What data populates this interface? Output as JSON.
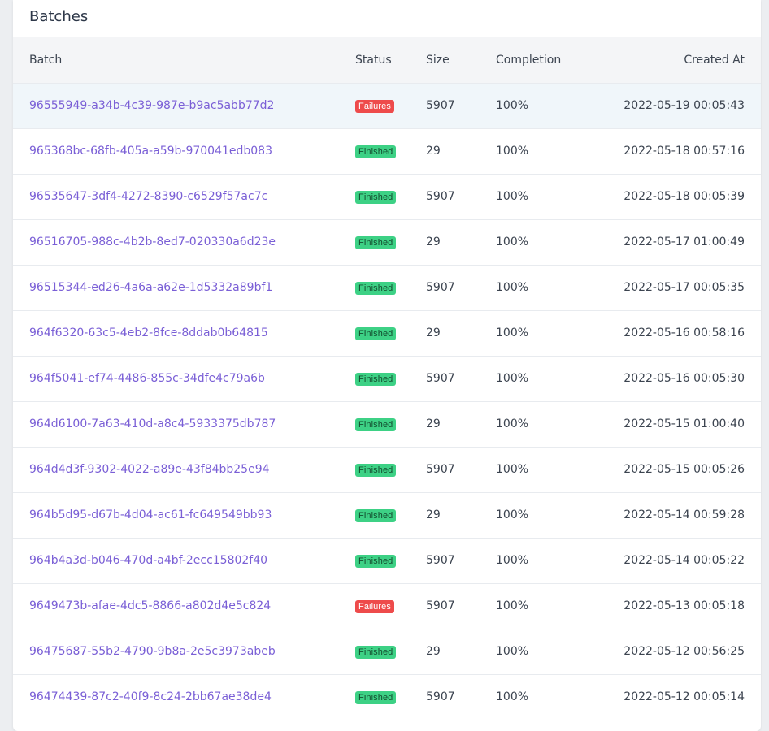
{
  "card": {
    "title": "Batches"
  },
  "table": {
    "headers": {
      "batch": "Batch",
      "status": "Status",
      "size": "Size",
      "completion": "Completion",
      "created_at": "Created At"
    },
    "rows": [
      {
        "id": "96555949-a34b-4c39-987e-b9ac5abb77d2",
        "status": "Failures",
        "size": "5907",
        "completion": "100%",
        "created_at": "2022-05-19 00:05:43"
      },
      {
        "id": "965368bc-68fb-405a-a59b-970041edb083",
        "status": "Finished",
        "size": "29",
        "completion": "100%",
        "created_at": "2022-05-18 00:57:16"
      },
      {
        "id": "96535647-3df4-4272-8390-c6529f57ac7c",
        "status": "Finished",
        "size": "5907",
        "completion": "100%",
        "created_at": "2022-05-18 00:05:39"
      },
      {
        "id": "96516705-988c-4b2b-8ed7-020330a6d23e",
        "status": "Finished",
        "size": "29",
        "completion": "100%",
        "created_at": "2022-05-17 01:00:49"
      },
      {
        "id": "96515344-ed26-4a6a-a62e-1d5332a89bf1",
        "status": "Finished",
        "size": "5907",
        "completion": "100%",
        "created_at": "2022-05-17 00:05:35"
      },
      {
        "id": "964f6320-63c5-4eb2-8fce-8ddab0b64815",
        "status": "Finished",
        "size": "29",
        "completion": "100%",
        "created_at": "2022-05-16 00:58:16"
      },
      {
        "id": "964f5041-ef74-4486-855c-34dfe4c79a6b",
        "status": "Finished",
        "size": "5907",
        "completion": "100%",
        "created_at": "2022-05-16 00:05:30"
      },
      {
        "id": "964d6100-7a63-410d-a8c4-5933375db787",
        "status": "Finished",
        "size": "29",
        "completion": "100%",
        "created_at": "2022-05-15 01:00:40"
      },
      {
        "id": "964d4d3f-9302-4022-a89e-43f84bb25e94",
        "status": "Finished",
        "size": "5907",
        "completion": "100%",
        "created_at": "2022-05-15 00:05:26"
      },
      {
        "id": "964b5d95-d67b-4d04-ac61-fc649549bb93",
        "status": "Finished",
        "size": "29",
        "completion": "100%",
        "created_at": "2022-05-14 00:59:28"
      },
      {
        "id": "964b4a3d-b046-470d-a4bf-2ecc15802f40",
        "status": "Finished",
        "size": "5907",
        "completion": "100%",
        "created_at": "2022-05-14 00:05:22"
      },
      {
        "id": "9649473b-afae-4dc5-8866-a802d4e5c824",
        "status": "Failures",
        "size": "5907",
        "completion": "100%",
        "created_at": "2022-05-13 00:05:18"
      },
      {
        "id": "96475687-55b2-4790-9b8a-2e5c3973abeb",
        "status": "Finished",
        "size": "29",
        "completion": "100%",
        "created_at": "2022-05-12 00:56:25"
      },
      {
        "id": "96474439-87c2-40f9-8c24-2bb67ae38de4",
        "status": "Finished",
        "size": "5907",
        "completion": "100%",
        "created_at": "2022-05-12 00:05:14"
      }
    ]
  },
  "colors": {
    "link": "#7a5fd6",
    "finished_badge": "#3dd185",
    "failures_badge": "#ee4b4b",
    "highlight_row": "#f0f6fa"
  }
}
